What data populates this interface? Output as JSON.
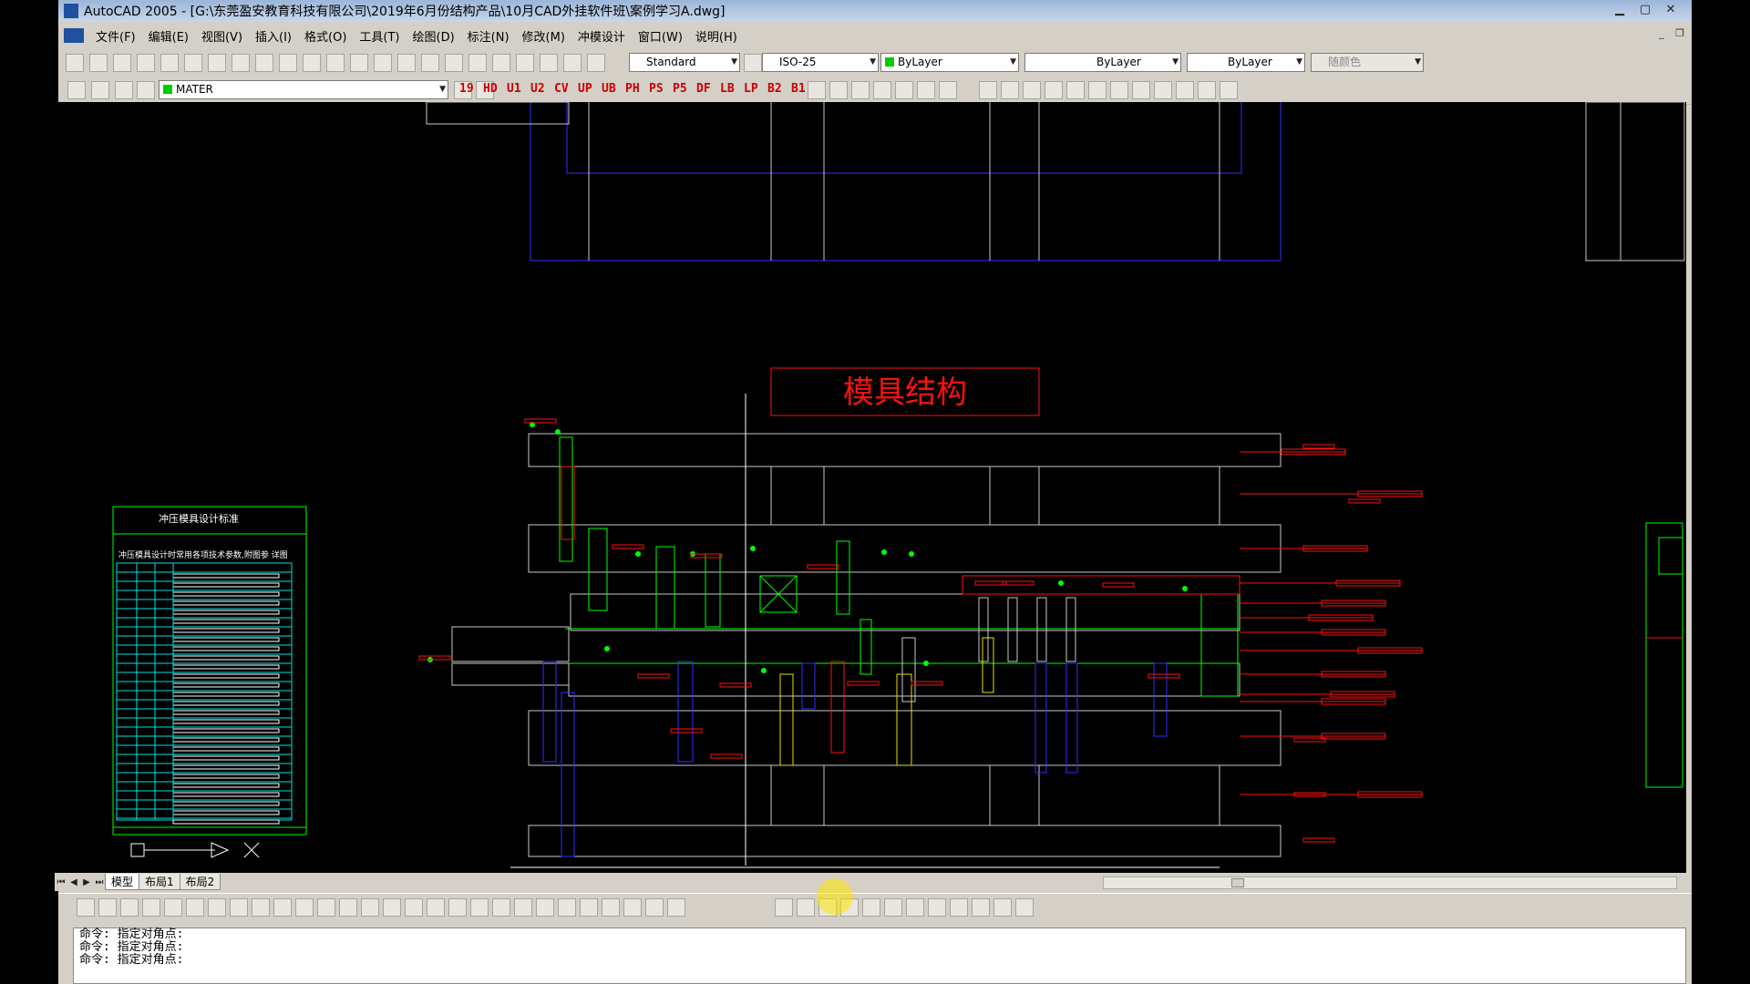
{
  "window": {
    "title": "AutoCAD 2005 - [G:\\东莞盈安教育科技有限公司\\2019年6月份结构产品\\10月CAD外挂软件班\\案例学习A.dwg]",
    "app_icon": "autocad-app-icon"
  },
  "menu": [
    "文件(F)",
    "编辑(E)",
    "视图(V)",
    "插入(I)",
    "格式(O)",
    "工具(T)",
    "绘图(D)",
    "标注(N)",
    "修改(M)",
    "冲模设计",
    "窗口(W)",
    "说明(H)"
  ],
  "toolbar1": {
    "text_style": "Standard",
    "dim_style": "ISO-25",
    "color": "ByLayer",
    "linetype": "ByLayer",
    "lineweight": "ByLayer",
    "plot_style": "随颜色",
    "color_swatch": "#00cc00"
  },
  "toolbar2": {
    "layer": "MATER",
    "layer_color": "#00cc00",
    "commands": [
      "19",
      "HD",
      "U1",
      "U2",
      "CV",
      "UP",
      "UB",
      "PH",
      "PS",
      "P5",
      "DF",
      "LB",
      "LP",
      "B2",
      "B1"
    ]
  },
  "drawing": {
    "title": "模具结构",
    "title_color": "#ff2020",
    "table_title": "冲压模具设计标准",
    "table_subtitle": "冲压模具设计时常用各项技术参数,附图参 详图",
    "palette": {
      "plate": "#c8c8c8",
      "green": "#00ff00",
      "red": "#ff1010",
      "blue": "#3030ff",
      "cyan": "#00e0e0",
      "yellow": "#e0e000"
    }
  },
  "layout_tabs": [
    "模型",
    "布局1",
    "布局2"
  ],
  "active_tab": "模型",
  "command_history": [
    "命令: 指定对角点:",
    "命令: 指定对角点:",
    "命令: 指定对角点:"
  ]
}
